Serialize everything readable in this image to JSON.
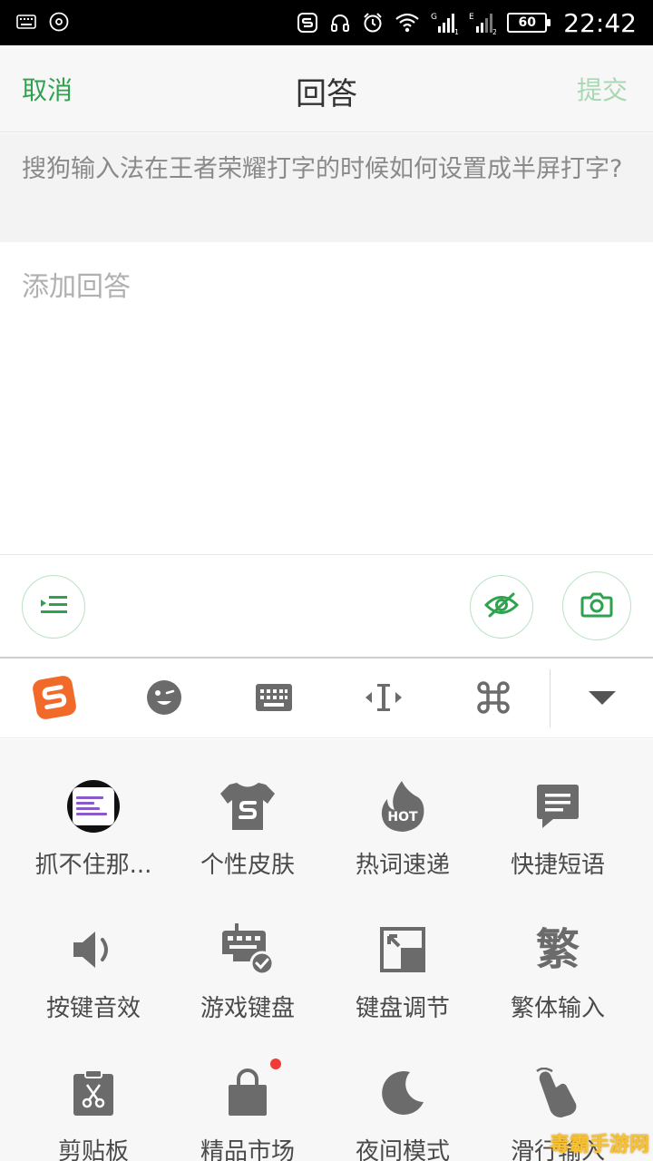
{
  "status_bar": {
    "time": "22:42",
    "battery": "60",
    "sim1_label": "G",
    "sim2_label": "E"
  },
  "header": {
    "cancel": "取消",
    "title": "回答",
    "submit": "提交"
  },
  "question": {
    "text": "搜狗输入法在王者荣耀打字的时候如何设置成半屏打字?"
  },
  "answer": {
    "placeholder": "添加回答"
  },
  "tool_row": {
    "icons": [
      "indent-list-icon",
      "eye-off-icon",
      "camera-icon"
    ]
  },
  "keyboard_toolbar": {
    "icons": [
      "sogou-logo-icon",
      "emoji-icon",
      "keyboard-icon",
      "cursor-icon",
      "command-icon",
      "collapse-arrow-icon"
    ]
  },
  "grid": {
    "items": [
      {
        "label": "抓不住那...",
        "icon": "avatar"
      },
      {
        "label": "个性皮肤",
        "icon": "tshirt-icon"
      },
      {
        "label": "热词速递",
        "icon": "hot-flame-icon"
      },
      {
        "label": "快捷短语",
        "icon": "message-icon"
      },
      {
        "label": "按键音效",
        "icon": "speaker-icon"
      },
      {
        "label": "游戏键盘",
        "icon": "game-keyboard-icon"
      },
      {
        "label": "键盘调节",
        "icon": "resize-icon"
      },
      {
        "label": "繁体输入",
        "icon": "traditional-char-icon",
        "glyph": "繁"
      },
      {
        "label": "剪贴板",
        "icon": "clipboard-icon"
      },
      {
        "label": "精品市场",
        "icon": "shopping-bag-icon"
      },
      {
        "label": "夜间模式",
        "icon": "moon-icon"
      },
      {
        "label": "滑行输入",
        "icon": "swipe-hand-icon"
      }
    ]
  },
  "watermark": "毒霸手游网",
  "colors": {
    "accent": "#2fa24f",
    "submit_disabled": "#a8d8b3",
    "sogou_orange": "#f26a2a",
    "icon_gray": "#6b6b6b"
  }
}
